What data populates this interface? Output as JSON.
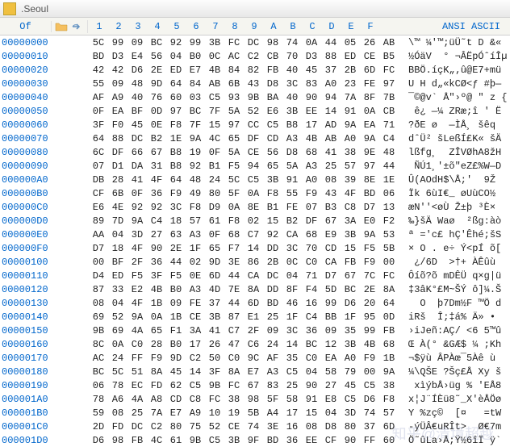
{
  "title": ".Seoul",
  "header": {
    "offset_label": "Of",
    "hex_cols": [
      "1",
      "2",
      "3",
      "4",
      "5",
      "6",
      "7",
      "8",
      "9",
      "A",
      "B",
      "C",
      "D",
      "E",
      "F"
    ],
    "text_label": "ANSI ASCII"
  },
  "rows": [
    {
      "offset": "00000000",
      "hex": [
        "5C",
        "99",
        "09",
        "BC",
        "92",
        "99",
        "3B",
        "FC",
        "DC",
        "98",
        "74",
        "0A",
        "44",
        "05",
        "26",
        "AB"
      ],
      "text": "\\™ ¼'™;üÜ˜t D &«"
    },
    {
      "offset": "00000010",
      "hex": [
        "BD",
        "D3",
        "E4",
        "56",
        "04",
        "B0",
        "0C",
        "AC",
        "C2",
        "CB",
        "70",
        "D3",
        "88",
        "ED",
        "CE",
        "B5"
      ],
      "text": "½ÓäV  ° ¬ÂËpÓˆíÎµ"
    },
    {
      "offset": "00000020",
      "hex": [
        "42",
        "42",
        "D6",
        "2E",
        "ED",
        "E7",
        "4B",
        "84",
        "82",
        "FB",
        "40",
        "45",
        "37",
        "2B",
        "6D",
        "FC"
      ],
      "text": "BBÖ.íçK„‚û@E7+mü"
    },
    {
      "offset": "00000030",
      "hex": [
        "55",
        "09",
        "48",
        "9D",
        "64",
        "84",
        "AB",
        "6B",
        "43",
        "D8",
        "3C",
        "83",
        "A0",
        "23",
        "FE",
        "97"
      ],
      "text": "U H d„«kCØ<ƒ #þ—"
    },
    {
      "offset": "00000040",
      "hex": [
        "AF",
        "A9",
        "40",
        "76",
        "60",
        "03",
        "C5",
        "93",
        "9B",
        "BA",
        "40",
        "90",
        "94",
        "7A",
        "8F",
        "7B"
      ],
      "text": "¯©@v` Å\"›º@ \" z {"
    },
    {
      "offset": "00000050",
      "hex": [
        "0F",
        "EA",
        "BF",
        "0D",
        "97",
        "BC",
        "7F",
        "5A",
        "52",
        "E6",
        "3B",
        "EE",
        "14",
        "91",
        "0A",
        "CB"
      ],
      "text": " ê¿ —¼ ZRæ;î ' Ë"
    },
    {
      "offset": "00000060",
      "hex": [
        "3F",
        "F0",
        "45",
        "0E",
        "F8",
        "7F",
        "15",
        "97",
        "CC",
        "C5",
        "B8",
        "17",
        "AD",
        "9A",
        "EA",
        "71"
      ],
      "text": "?ðE ø  —ÌÅ¸ ­šêq"
    },
    {
      "offset": "00000070",
      "hex": [
        "64",
        "88",
        "DC",
        "B2",
        "1E",
        "9A",
        "4C",
        "65",
        "DF",
        "CD",
        "A3",
        "4B",
        "AB",
        "A0",
        "9A",
        "C4"
      ],
      "text": "dˆÜ² šLeßÍ£K« šÄ"
    },
    {
      "offset": "00000080",
      "hex": [
        "6C",
        "DF",
        "66",
        "67",
        "B8",
        "19",
        "0F",
        "5A",
        "CE",
        "56",
        "D8",
        "68",
        "41",
        "38",
        "9E",
        "48"
      ],
      "text": "lßfg¸  ZÎVØhA8žH"
    },
    {
      "offset": "00000090",
      "hex": [
        "07",
        "D1",
        "DA",
        "31",
        "B8",
        "92",
        "B1",
        "F5",
        "94",
        "65",
        "5A",
        "A3",
        "25",
        "57",
        "97",
        "44"
      ],
      "text": " ÑÚ1¸'±õ\"eZ£%W—D"
    },
    {
      "offset": "000000A0",
      "hex": [
        "DB",
        "28",
        "41",
        "4F",
        "64",
        "48",
        "24",
        "5C",
        "C5",
        "3B",
        "91",
        "A0",
        "08",
        "39",
        "8E",
        "1E"
      ],
      "text": "Û(AOdH$\\Å;'  9Ž"
    },
    {
      "offset": "000000B0",
      "hex": [
        "CF",
        "6B",
        "0F",
        "36",
        "F9",
        "49",
        "80",
        "5F",
        "0A",
        "F8",
        "55",
        "F9",
        "43",
        "4F",
        "BD",
        "06"
      ],
      "text": "Ïk 6ùI€_ øUùCO½"
    },
    {
      "offset": "000000C0",
      "hex": [
        "E6",
        "4E",
        "92",
        "92",
        "3C",
        "F8",
        "D9",
        "0A",
        "8E",
        "B1",
        "FE",
        "07",
        "B3",
        "C8",
        "D7",
        "13"
      ],
      "text": "æN''<øÙ Ž±þ ³È×"
    },
    {
      "offset": "000000D0",
      "hex": [
        "89",
        "7D",
        "9A",
        "C4",
        "18",
        "57",
        "61",
        "F8",
        "02",
        "15",
        "B2",
        "DF",
        "67",
        "3A",
        "E0",
        "F2"
      ],
      "text": "‰}šÄ Waø  ²ßg:àò"
    },
    {
      "offset": "000000E0",
      "hex": [
        "AA",
        "04",
        "3D",
        "27",
        "63",
        "A3",
        "0F",
        "68",
        "C7",
        "92",
        "CA",
        "68",
        "E9",
        "3B",
        "9A",
        "53"
      ],
      "text": "ª ='c£ hÇ'Êhé;šS"
    },
    {
      "offset": "000000F0",
      "hex": [
        "D7",
        "18",
        "4F",
        "90",
        "2E",
        "1F",
        "65",
        "F7",
        "14",
        "DD",
        "3C",
        "70",
        "CD",
        "15",
        "F5",
        "5B"
      ],
      "text": "× O . e÷ Ý<pÍ õ["
    },
    {
      "offset": "00000100",
      "hex": [
        "00",
        "BF",
        "2F",
        "36",
        "44",
        "02",
        "9D",
        "3E",
        "86",
        "2B",
        "0C",
        "C0",
        "CA",
        "FB",
        "F9",
        "00"
      ],
      "text": " ¿/6D  >†+ ÀÊûù"
    },
    {
      "offset": "00000110",
      "hex": [
        "D4",
        "ED",
        "F5",
        "3F",
        "F5",
        "0E",
        "6D",
        "44",
        "CA",
        "DC",
        "04",
        "71",
        "D7",
        "67",
        "7C",
        "FC"
      ],
      "text": "Ôíõ?õ mDÊÜ q×g|ü"
    },
    {
      "offset": "00000120",
      "hex": [
        "87",
        "33",
        "E2",
        "4B",
        "B0",
        "A3",
        "4D",
        "7E",
        "8A",
        "DD",
        "8F",
        "F4",
        "5D",
        "BC",
        "2E",
        "8A"
      ],
      "text": "‡3âK°£M~ŠÝ ô]¼.Š"
    },
    {
      "offset": "00000130",
      "hex": [
        "08",
        "04",
        "4F",
        "1B",
        "09",
        "FE",
        "37",
        "44",
        "6D",
        "BD",
        "46",
        "16",
        "99",
        "D6",
        "20",
        "64"
      ],
      "text": "  O  þ7Dm½F ™Ö d"
    },
    {
      "offset": "00000140",
      "hex": [
        "69",
        "52",
        "9A",
        "0A",
        "1B",
        "CE",
        "3B",
        "87",
        "E1",
        "25",
        "1F",
        "C4",
        "BB",
        "1F",
        "95",
        "0D"
      ],
      "text": "iRš  Î;‡á% Ä» •"
    },
    {
      "offset": "00000150",
      "hex": [
        "9B",
        "69",
        "4A",
        "65",
        "F1",
        "3A",
        "41",
        "C7",
        "2F",
        "09",
        "3C",
        "36",
        "09",
        "35",
        "99",
        "FB"
      ],
      "text": "›iJeñ:AÇ/ <6 5™û"
    },
    {
      "offset": "00000160",
      "hex": [
        "8C",
        "0A",
        "C0",
        "28",
        "B0",
        "17",
        "26",
        "47",
        "C6",
        "24",
        "14",
        "BC",
        "12",
        "3B",
        "4B",
        "68"
      ],
      "text": "Œ À(° &GÆ$ ¼ ;Kh"
    },
    {
      "offset": "00000170",
      "hex": [
        "AC",
        "24",
        "FF",
        "F9",
        "9D",
        "C2",
        "50",
        "C0",
        "9C",
        "AF",
        "35",
        "C0",
        "EA",
        "A0",
        "F9",
        "1B"
      ],
      "text": "¬$ÿù ÂPÀœ¯5Àê ù"
    },
    {
      "offset": "00000180",
      "hex": [
        "BC",
        "5C",
        "51",
        "8A",
        "45",
        "14",
        "3F",
        "8A",
        "E7",
        "A3",
        "C5",
        "04",
        "58",
        "79",
        "00",
        "9A"
      ],
      "text": "¼\\QŠE ?Šç£Å Xy š"
    },
    {
      "offset": "00000190",
      "hex": [
        "06",
        "78",
        "EC",
        "FD",
        "62",
        "C5",
        "9B",
        "FC",
        "67",
        "83",
        "25",
        "90",
        "27",
        "45",
        "C5",
        "38"
      ],
      "text": " xìýbÅ›üg % 'EÅ8"
    },
    {
      "offset": "000001A0",
      "hex": [
        "78",
        "A6",
        "4A",
        "A8",
        "CD",
        "C8",
        "FC",
        "38",
        "98",
        "5F",
        "58",
        "91",
        "E8",
        "C5",
        "D6",
        "F8"
      ],
      "text": "x¦J¨ÍÈü8˜_X'èÅÖø"
    },
    {
      "offset": "000001B0",
      "hex": [
        "59",
        "08",
        "25",
        "7A",
        "E7",
        "A9",
        "10",
        "19",
        "5B",
        "A4",
        "17",
        "15",
        "04",
        "3D",
        "74",
        "57"
      ],
      "text": "Y %zç©  [¤   =tW"
    },
    {
      "offset": "000001C0",
      "hex": [
        "2D",
        "FD",
        "DC",
        "C2",
        "80",
        "75",
        "52",
        "CE",
        "74",
        "3E",
        "16",
        "08",
        "D8",
        "80",
        "37",
        "6D"
      ],
      "text": "-ýÜÂ€uRÎt>  Ø€7m"
    },
    {
      "offset": "000001D0",
      "hex": [
        "D6",
        "98",
        "FB",
        "4C",
        "61",
        "9B",
        "C5",
        "3B",
        "9F",
        "BD",
        "36",
        "EE",
        "CF",
        "90",
        "FF",
        "60"
      ],
      "text": "Ö˜ûLa›Å;Ÿ½6îÏ ÿ`"
    }
  ]
}
